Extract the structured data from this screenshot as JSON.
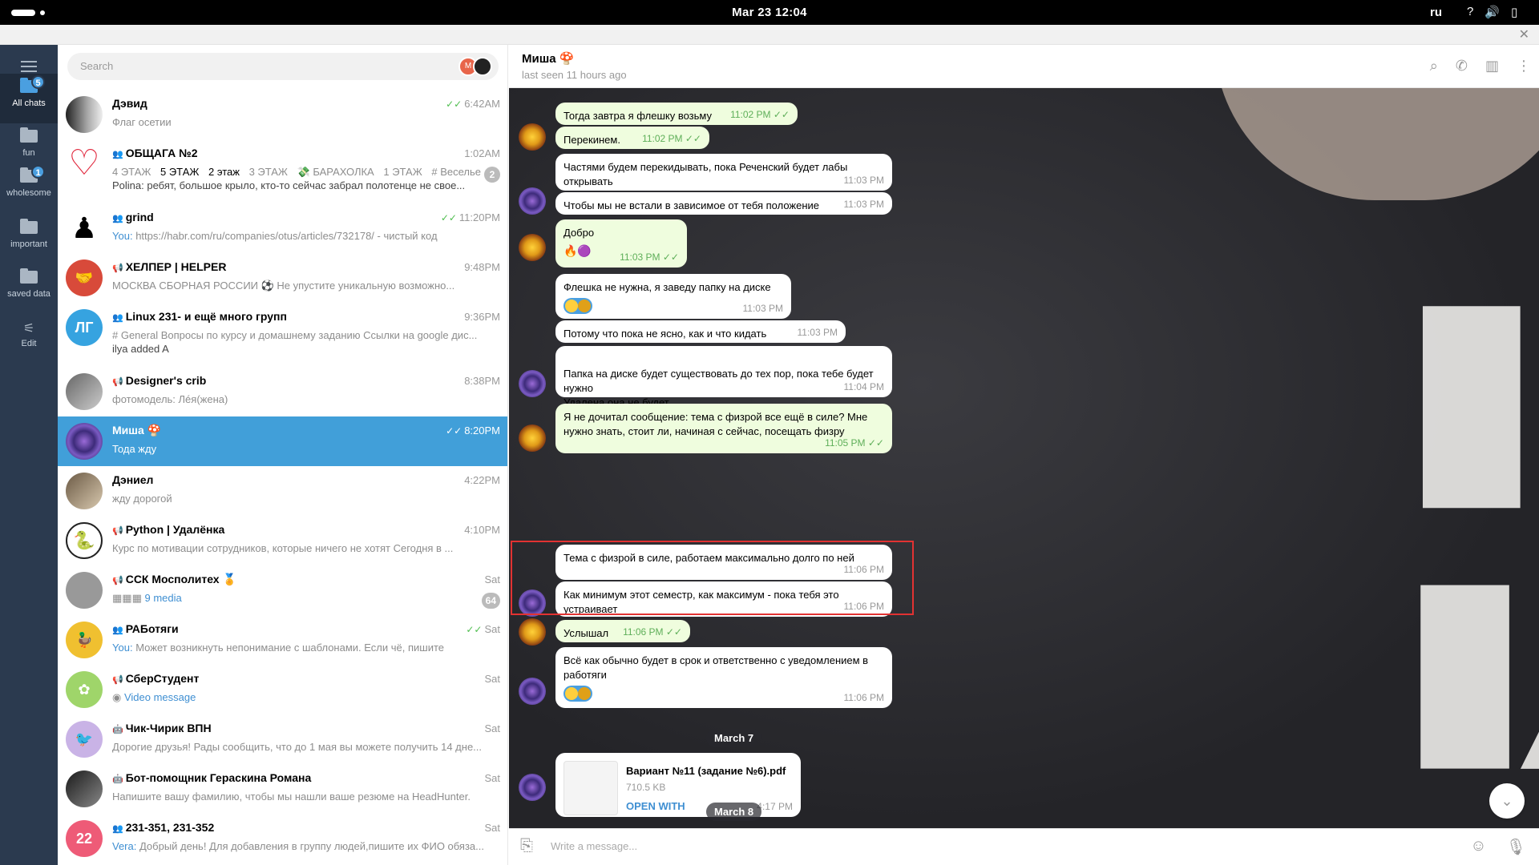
{
  "system": {
    "clock": "Mar 23  12:04",
    "lang": "ru"
  },
  "rail": {
    "items": [
      {
        "label": "All chats",
        "badge": "5"
      },
      {
        "label": "fun"
      },
      {
        "label": "wholesome",
        "badge": "1"
      },
      {
        "label": "important"
      },
      {
        "label": "saved data"
      },
      {
        "label": "Edit"
      }
    ]
  },
  "search": {
    "placeholder": "Search",
    "accounts": [
      "M",
      ""
    ]
  },
  "chats": [
    {
      "name": "Дэвид",
      "time": "6:42AM",
      "preview": "Флаг осетии",
      "read": true
    },
    {
      "name": "ОБЩАГА №2",
      "time": "1:02AM",
      "tags": [
        "4 ЭТАЖ",
        "5 ЭТАЖ",
        "2 этаж",
        "3 ЭТАЖ",
        "💸 БАРАХОЛКА",
        "1 ЭТАЖ",
        "# Веселье"
      ],
      "preview": "Polina: ребят, большое крыло, кто-то сейчас забрал полотенце не свое...",
      "count": "2"
    },
    {
      "name": "grind",
      "time": "11:20PM",
      "sender": "You:",
      "preview": "https://habr.com/ru/companies/otus/articles/732178/ - чистый код",
      "read": true
    },
    {
      "name": "ХЕЛПЕР | HELPER",
      "time": "9:48PM",
      "preview": "МОСКВА СБОРНАЯ РОССИИ ⚽ Не упустите уникальную возможно..."
    },
    {
      "name": "Linux 231- и ещё много групп",
      "time": "9:36PM",
      "preview": "# General  Вопросы по курсу и домашнему заданию  Ссылки на google дис...",
      "preview2": "ilya added A"
    },
    {
      "name": "Designer's crib",
      "time": "8:38PM",
      "preview": "фотомодель: Лéя(жена)"
    },
    {
      "name": "Миша 🍄",
      "time": "8:20PM",
      "preview": "Тода жду",
      "read": true
    },
    {
      "name": "Дэниел",
      "time": "4:22PM",
      "preview": "жду дорогой"
    },
    {
      "name": "Python | Удалёнка",
      "time": "4:10PM",
      "preview": "Курс по мотивации сотрудников, которые ничего не хотят  Сегодня в ..."
    },
    {
      "name": "ССК Мосполитех 🏅",
      "time": "Sat",
      "sender": "",
      "preview": "9 media",
      "count": "64"
    },
    {
      "name": "РАБотяги",
      "time": "Sat",
      "sender": "You:",
      "preview": "Может возникнуть непонимание с шаблонами. Если  чё, пишите",
      "read": true
    },
    {
      "name": "СберСтудент",
      "time": "Sat",
      "preview": "Video message"
    },
    {
      "name": "Чик-Чирик ВПН",
      "time": "Sat",
      "preview": "Дорогие друзья!  Рады сообщить, что до 1 мая вы можете получить 14 дне..."
    },
    {
      "name": "Бот-помощник Гераскина Романа",
      "time": "Sat",
      "preview": "Напишите вашу фамилию, чтобы мы нашли ваше резюме на HeadHunter."
    },
    {
      "name": "231-351, 231-352",
      "time": "Sat",
      "sender": "Vera:",
      "preview": "Добрый день! Для добавления в группу людей,пишите их ФИО обяза...",
      "avatar_text": "22"
    }
  ],
  "chat": {
    "title": "Миша 🍄",
    "status": "last seen 11 hours ago",
    "messages": [
      {
        "text": "Тогда завтра я флешку возьму",
        "time": "11:02 PM",
        "out": true
      },
      {
        "text": "Перекинем.",
        "time": "11:02 PM",
        "out": true
      },
      {
        "text": "Частями будем перекидывать, пока Реченский будет лабы открывать",
        "time": "11:03 PM",
        "out": false
      },
      {
        "text": "Чтобы мы не встали в зависимое от тебя положение",
        "time": "11:03 PM",
        "out": false
      },
      {
        "text": "Добро",
        "time": "11:03 PM",
        "out": true
      },
      {
        "text": "Флешка не нужна, я заведу папку на диске",
        "time": "11:03 PM",
        "out": false
      },
      {
        "text": "Потому что пока не ясно, как и что кидать",
        "time": "11:03 PM",
        "out": false
      },
      {
        "text": "Папка на диске будет существовать до тех пор, пока тебе будет нужно\nУдалена она не будет",
        "time": "11:04 PM",
        "out": false
      },
      {
        "text": "Я не дочитал сообщение: тема с физрой все ещё в силе? Мне нужно знать, стоит ли, начиная с сейчас, посещать физру",
        "time": "11:05 PM",
        "out": true
      },
      {
        "text": "Тема с физрой в силе, работаем максимально долго по ней",
        "time": "11:06 PM",
        "out": false
      },
      {
        "text": "Как минимум этот семестр, как максимум - пока тебя это устраивает",
        "time": "11:06 PM",
        "out": false
      },
      {
        "text": "Услышал",
        "time": "11:06 PM",
        "out": true
      },
      {
        "text": "Всё как обычно будет в срок и ответственно с уведомлением в работяги",
        "time": "11:06 PM",
        "out": false
      }
    ],
    "dates": [
      "March 7",
      "March 8"
    ],
    "file": {
      "name": "Вариант №11 (задание №6).pdf",
      "size": "710.5 KB",
      "action": "OPEN WITH",
      "time": "4:17 PM"
    },
    "composer_placeholder": "Write a message..."
  },
  "colors": {
    "accent": "#419fd9",
    "rail": "#2b3a4f",
    "outgoing": "#effdde",
    "highlight_box": "#e23232"
  }
}
